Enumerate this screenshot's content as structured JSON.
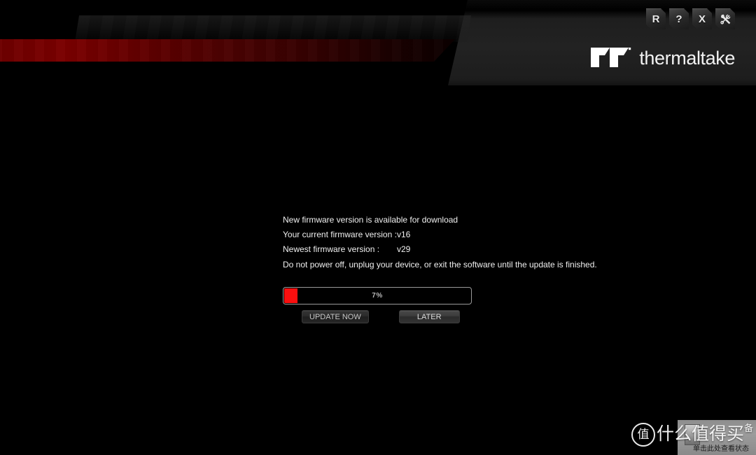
{
  "window": {
    "title_buttons": [
      {
        "name": "restore",
        "glyph": "R",
        "tooltip": "Restore"
      },
      {
        "name": "help",
        "glyph": "?",
        "tooltip": "Help"
      },
      {
        "name": "close",
        "glyph": "X",
        "tooltip": "Close"
      },
      {
        "name": "tools",
        "glyph": "tools-icon",
        "tooltip": "Settings"
      }
    ]
  },
  "brand": {
    "name": "thermaltake",
    "mark": "tt-logo-icon",
    "accent_color": "#7b0000",
    "stripe_color_start": "#7b0000",
    "stripe_color_end": "#0b0000"
  },
  "dialog": {
    "headline": "New firmware version is available for download",
    "current_version_label": "Your current firmware version :",
    "current_version_value": "v16",
    "newest_version_label": "Newest firmware version :",
    "newest_version_value": "v29",
    "warning": "Do not power off, unplug your device, or exit the software until the update is finished.",
    "progress": {
      "percent": 7,
      "display": "7%",
      "fill_color": "#fa0f0f",
      "track_color": "#000000",
      "border_color": "#9a9a9a"
    },
    "buttons": {
      "update_now": "UPDATE NOW",
      "later": "LATER"
    }
  },
  "watermark": {
    "badge": "值",
    "label": "什么值得买",
    "label_tail": "备",
    "tooltip_text": "单击此处查看状态"
  }
}
